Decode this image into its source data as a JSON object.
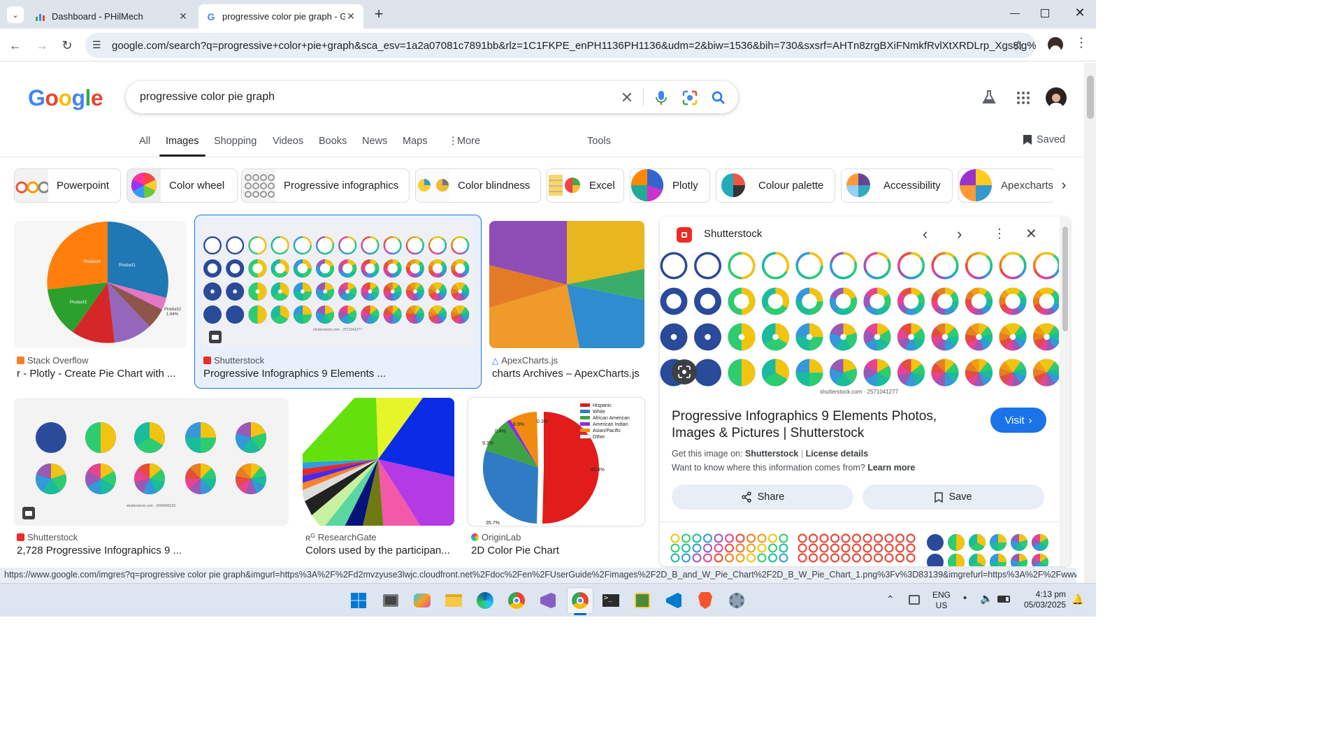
{
  "browser": {
    "tabs": [
      {
        "title": "Dashboard - PHilMech",
        "active": false
      },
      {
        "title": "progressive color pie graph - G",
        "active": true
      }
    ],
    "url": "google.com/search?q=progressive+color+pie+graph&sca_esv=1a2a07081c7891bb&rlz=1C1FKPE_enPH1136PH1136&udm=2&biw=1536&bih=730&sxsrf=AHTn8zrgBXiFNmkfRvlXtXRDLrp_Xgs8lg%3A..."
  },
  "search": {
    "logo": "Google",
    "query": "progressive color pie graph",
    "nav_tabs": [
      "All",
      "Images",
      "Shopping",
      "Videos",
      "Books",
      "News",
      "Maps",
      "More"
    ],
    "active_tab": "Images",
    "tools": "Tools",
    "saved": "Saved"
  },
  "chips": [
    "Powerpoint",
    "Color wheel",
    "Progressive infographics",
    "Color blindness",
    "Excel",
    "Plotly",
    "Colour palette",
    "Accessibility",
    "Apexcharts"
  ],
  "results": [
    {
      "source": "Stack Overflow",
      "title": "r - Plotly - Create Pie Chart with ..."
    },
    {
      "source": "Shutterstock",
      "title": "Progressive Infographics 9 Elements ...",
      "watermark": "shutterstock.com · 2571041277"
    },
    {
      "source": "ApexCharts.js",
      "title": "charts Archives – ApexCharts.js"
    },
    {
      "source": "Shutterstock",
      "title": "2,728 Progressive Infographics 9 ...",
      "watermark": "shutterstock.com · 2543996239"
    },
    {
      "source": "ResearchGate",
      "title": "Colors used by the participan..."
    },
    {
      "source": "OriginLab",
      "title": "2D Color Pie Chart"
    }
  ],
  "plotly_labels": [
    "Product4\n24.6%",
    "Product1\n31.7%",
    "Product3\n25%",
    "Product2\n1.64%"
  ],
  "origin_chart": {
    "legend": [
      "Hispanic",
      "White",
      "African American",
      "American Indian",
      "Asian/Pacific",
      "Other"
    ],
    "labels": [
      "0.3%",
      "8.9%",
      "0.4%",
      "9.3%",
      "45.4%",
      "35.7%"
    ]
  },
  "panel": {
    "source": "Shutterstock",
    "watermark": "shutterstock.com · 2571041277",
    "title": "Progressive Infographics 9 Elements Photos, Images & Pictures | Shutterstock",
    "visit": "Visit",
    "get_image_prefix": "Get this image on:",
    "get_image_source": "Shutterstock",
    "license": "License details",
    "info": "Want to know where this information comes from?",
    "learn_more": "Learn more",
    "share": "Share",
    "save": "Save"
  },
  "status_url": "https://www.google.com/imgres?q=progressive color pie graph&imgurl=https%3A%2F%2Fd2mvzyuse3lwjc.cloudfront.net%2Fdoc%2Fen%2FUserGuide%2Fimages%2F2D_B_and_W_Pie_Chart%2F2D_B_W_Pie_Chart_1.png%3Fv%3D83139&imgrefurl=https%3A%2F%2Fwww.originlab....",
  "taskbar": {
    "lang": "ENG",
    "region": "US",
    "time": "4:13 pm",
    "date": "05/03/2025"
  },
  "colors": {
    "accent": "#1a73e8",
    "tab_strip": "#dfe4ec",
    "omnibox": "#e9eef6",
    "selected_card": "#e8f0fe"
  }
}
